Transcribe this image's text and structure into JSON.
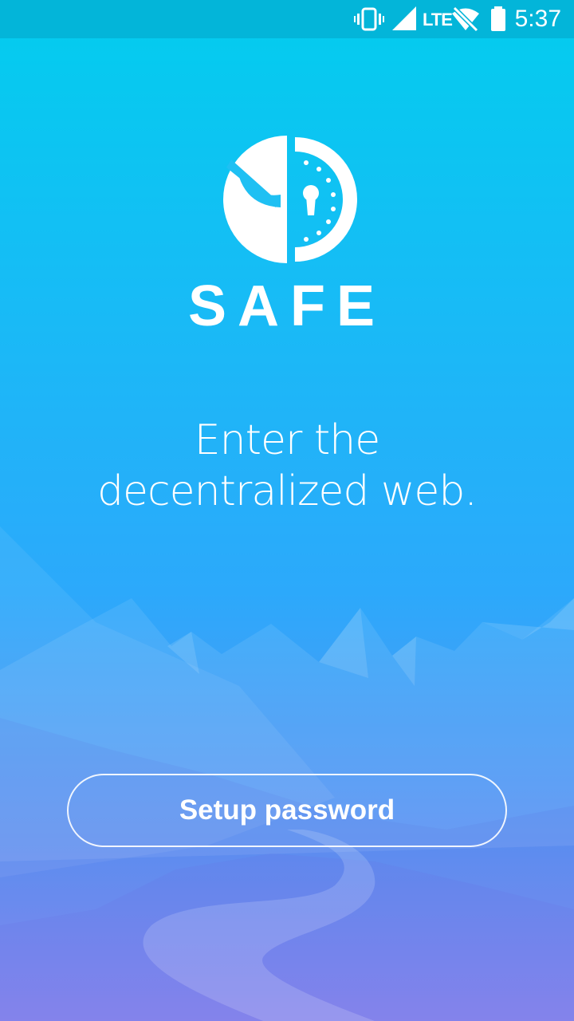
{
  "status_bar": {
    "time": "5:37",
    "network_type": "LTE",
    "icons": [
      "vibrate-icon",
      "signal-icon",
      "lte-icon",
      "wifi-off-icon",
      "battery-icon"
    ]
  },
  "brand": {
    "name": "SAFE",
    "logo_icon": "safe-logo-icon"
  },
  "tagline": {
    "line1": "Enter the",
    "line2": "decentralized web."
  },
  "actions": {
    "setup_label": "Setup password"
  },
  "colors": {
    "status_bar": "#03b5d9",
    "gradient_top": "#02cdee",
    "gradient_bottom": "#8f8cf0",
    "foreground": "#ffffff"
  }
}
